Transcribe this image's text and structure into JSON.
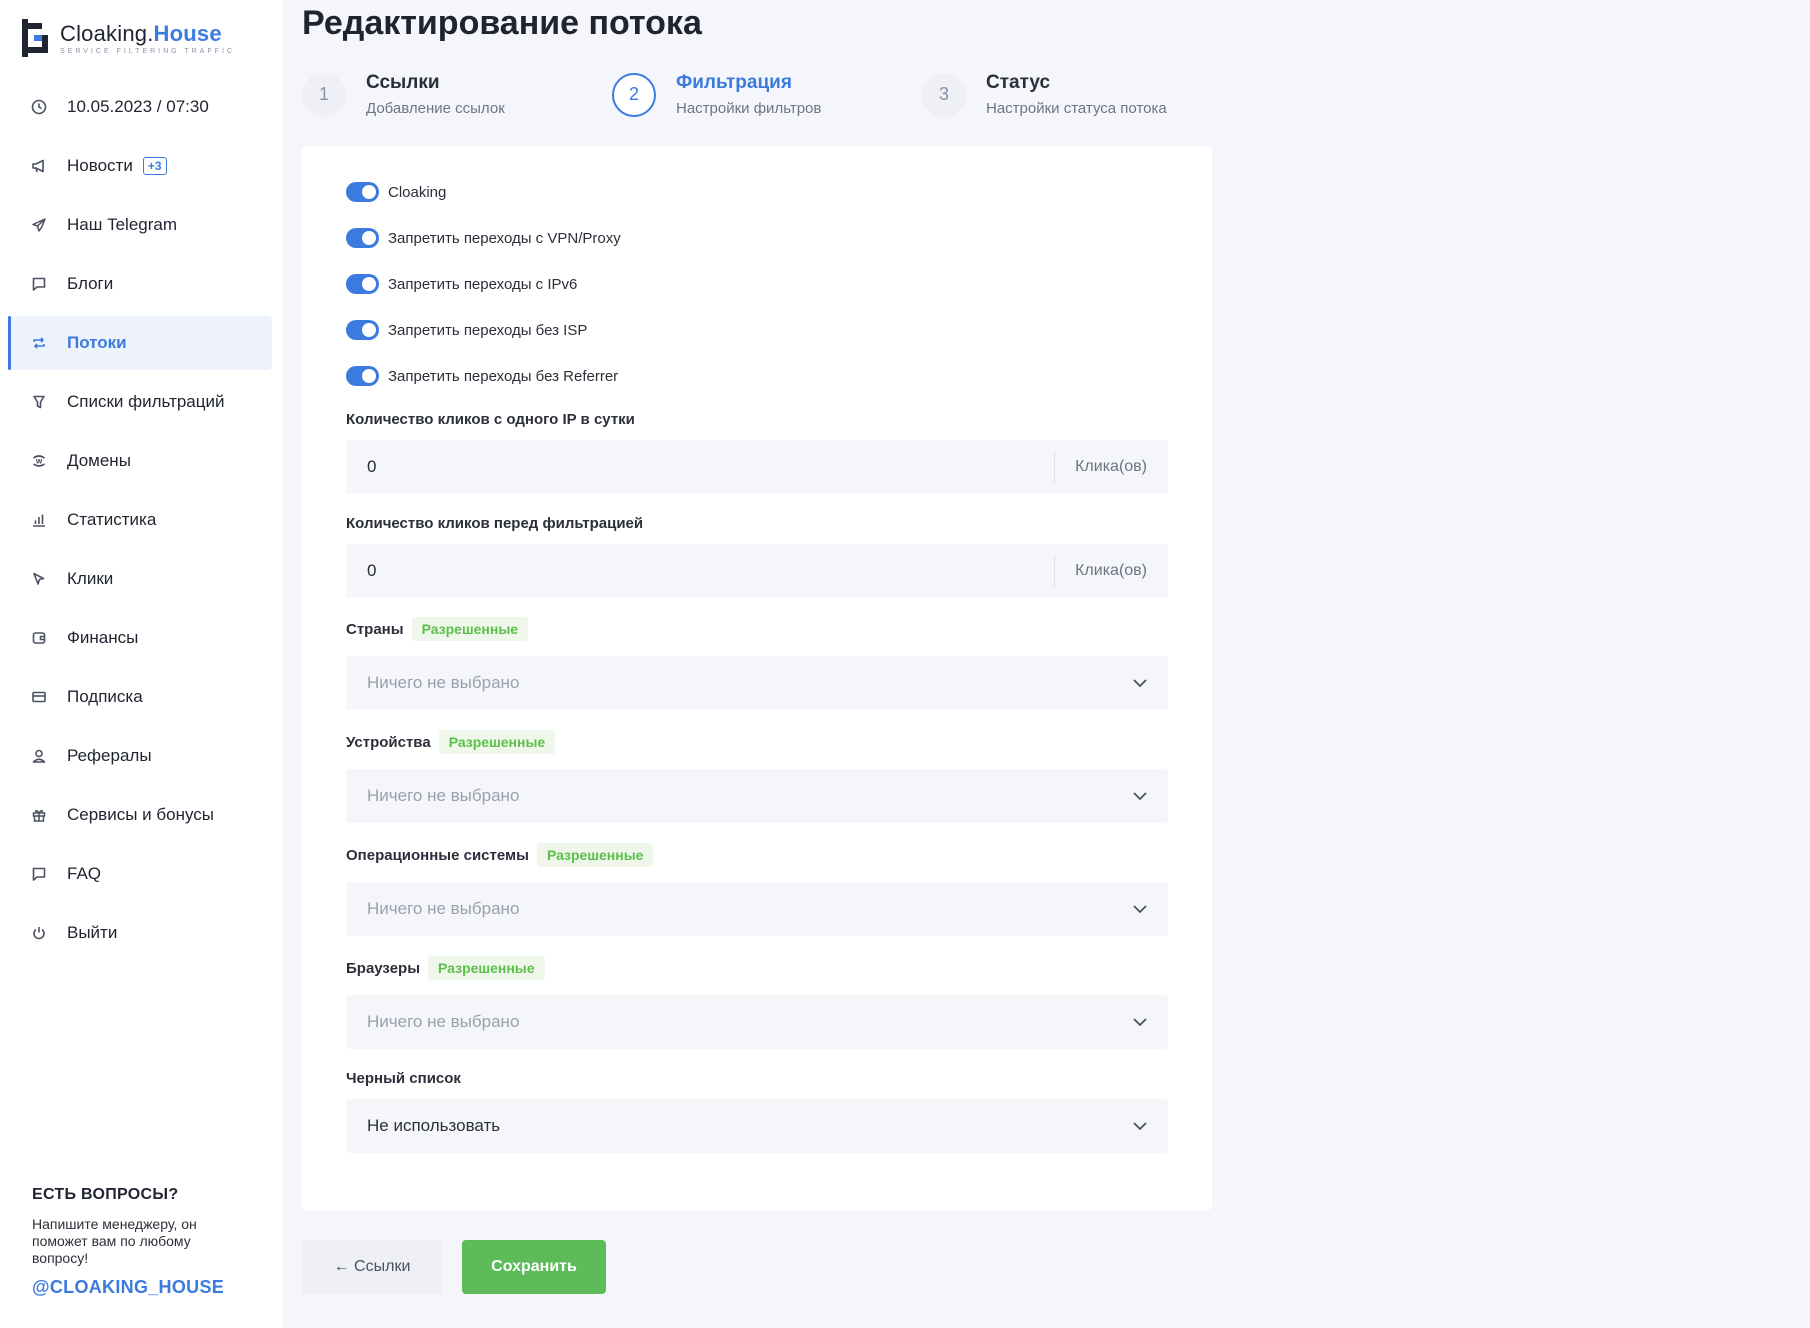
{
  "brand": {
    "name_part1": "Cloaking.",
    "name_part2": "House",
    "tagline": "SERVICE FILTERING TRAFFIC"
  },
  "sidebar": {
    "items": [
      {
        "label": "10.05.2023 / 07:30",
        "icon": "clock-icon"
      },
      {
        "label": "Новости",
        "icon": "megaphone-icon",
        "badge": "+3"
      },
      {
        "label": "Наш Telegram",
        "icon": "telegram-icon"
      },
      {
        "label": "Блоги",
        "icon": "chat-icon"
      },
      {
        "label": "Потоки",
        "icon": "repeat-icon",
        "active": true
      },
      {
        "label": "Списки фильтраций",
        "icon": "filter-icon"
      },
      {
        "label": "Домены",
        "icon": "globe-icon"
      },
      {
        "label": "Статистика",
        "icon": "bar-chart-icon"
      },
      {
        "label": "Клики",
        "icon": "cursor-icon"
      },
      {
        "label": "Финансы",
        "icon": "wallet-icon"
      },
      {
        "label": "Подписка",
        "icon": "card-icon"
      },
      {
        "label": "Рефералы",
        "icon": "user-icon"
      },
      {
        "label": "Сервисы и бонусы",
        "icon": "gift-icon"
      },
      {
        "label": "FAQ",
        "icon": "chat-icon"
      },
      {
        "label": "Выйти",
        "icon": "power-icon"
      }
    ]
  },
  "help": {
    "title": "ЕСТЬ ВОПРОСЫ?",
    "text": "Напишите менеджеру, он поможет вам по любому вопросу!",
    "link": "@CLOAKING_HOUSE"
  },
  "page": {
    "title": "Редактирование потока"
  },
  "steps": [
    {
      "num": "1",
      "title": "Ссылки",
      "sub": "Добавление ссылок"
    },
    {
      "num": "2",
      "title": "Фильтрация",
      "sub": "Настройки фильтров",
      "active": true
    },
    {
      "num": "3",
      "title": "Статус",
      "sub": "Настройки статуса потока"
    }
  ],
  "toggles": [
    {
      "label": "Cloaking",
      "on": true
    },
    {
      "label": "Запретить переходы с VPN/Proxy",
      "on": true
    },
    {
      "label": "Запретить переходы с IPv6",
      "on": true
    },
    {
      "label": "Запретить переходы без ISP",
      "on": true
    },
    {
      "label": "Запретить переходы без Referrer",
      "on": true
    }
  ],
  "clicks_per_ip": {
    "label": "Количество кликов с одного IP в сутки",
    "value": "0",
    "suffix": "Клика(ов)"
  },
  "clicks_before": {
    "label": "Количество кликов перед фильтрацией",
    "value": "0",
    "suffix": "Клика(ов)"
  },
  "selects": [
    {
      "label": "Страны",
      "tag": "Разрешенные",
      "value": "Ничего не выбрано"
    },
    {
      "label": "Устройства",
      "tag": "Разрешенные",
      "value": "Ничего не выбрано"
    },
    {
      "label": "Операционные системы",
      "tag": "Разрешенные",
      "value": "Ничего не выбрано"
    },
    {
      "label": "Браузеры",
      "tag": "Разрешенные",
      "value": "Ничего не выбрано"
    }
  ],
  "blacklist": {
    "label": "Черный список",
    "value": "Не использовать"
  },
  "buttons": {
    "back": "← Ссылки",
    "save": "Сохранить"
  },
  "colors": {
    "accent": "#3b7be0",
    "success": "#5dbb5a",
    "tag_green": "#5cbf4a"
  }
}
